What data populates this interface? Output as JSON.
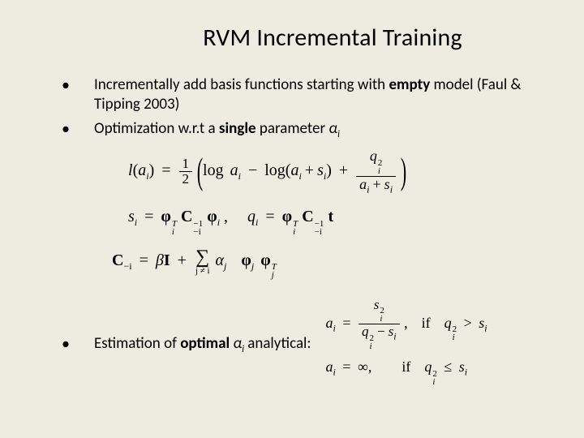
{
  "title": "RVM Incremental Training",
  "bullets": {
    "b1_pre": "Incrementally add basis functions starting with ",
    "b1_bold": "empty",
    "b1_post": " model (Faul & Tipping 2003)",
    "b2_pre": "Optimization w.r.t a ",
    "b2_bold": "single",
    "b2_post": " parameter ",
    "b2_sym": "α",
    "b2_sub": "i",
    "b3_pre": "Estimation of ",
    "b3_bold": "optimal",
    "b3_post1": " ",
    "b3_sym": "α",
    "b3_sub": "i",
    "b3_post2": " analytical:"
  },
  "eq": {
    "l_label": "l",
    "a": "a",
    "ai": "i",
    "half_num": "1",
    "half_den": "2",
    "log": "log",
    "s": "s",
    "si": "i",
    "q": "q",
    "qi": "i",
    "sq2": "2",
    "s_eq_lhs": "s",
    "s_eq_i": "i",
    "phi": "φ",
    "phi_i": "i",
    "T": "T",
    "C": "C",
    "Cmi": "−i",
    "Cinv": "−1",
    "q_eq_lhs": "q",
    "tvec": "t",
    "beta": "β",
    "I": "I",
    "alpha": "α",
    "aj": "j",
    "sum_lim": "j ≠ i",
    "phij": "j",
    "cond_if": "if",
    "cond_gt": ">",
    "cond_le": "≤",
    "inf": "∞",
    "comma": ","
  }
}
